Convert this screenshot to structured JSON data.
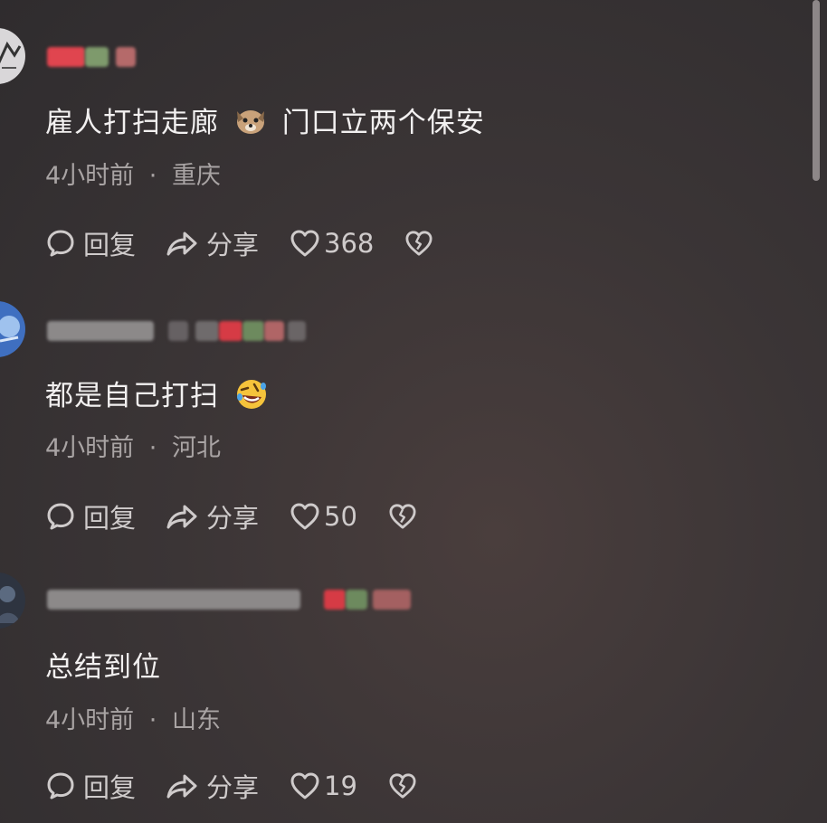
{
  "comments": [
    {
      "text": "雇人打扫走廊",
      "text_after_emoji": "门口立两个保安",
      "emoji": "dog-face-emoji",
      "time": "4小时前",
      "separator": "·",
      "location": "重庆",
      "reply_label": "回复",
      "share_label": "分享",
      "likes": "368"
    },
    {
      "text": "都是自己打扫",
      "text_after_emoji": "",
      "emoji": "rolling-laughing-emoji",
      "time": "4小时前",
      "separator": "·",
      "location": "河北",
      "reply_label": "回复",
      "share_label": "分享",
      "likes": "50"
    },
    {
      "text": "总结到位",
      "text_after_emoji": "",
      "emoji": "",
      "time": "4小时前",
      "separator": "·",
      "location": "山东",
      "reply_label": "回复",
      "share_label": "分享",
      "likes": "19"
    }
  ],
  "colors": {
    "background": "#3b3536",
    "text": "#f2f0f0",
    "meta": "#a9a4a4",
    "blur_red": "#d63b45",
    "blur_green": "#6d8a5e"
  }
}
